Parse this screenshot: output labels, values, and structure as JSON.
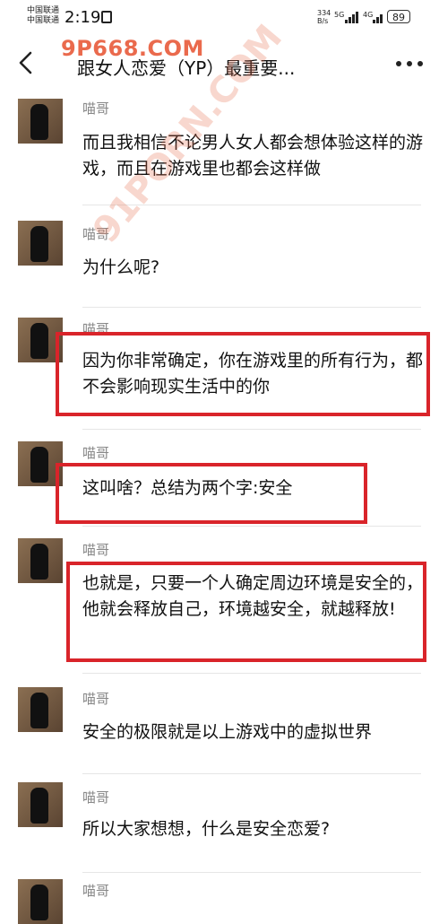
{
  "status_bar": {
    "carrier_1": "中国联通",
    "carrier_2": "中国联通",
    "time": "2:19",
    "net_speed_value": "334",
    "net_speed_unit": "B/s",
    "sim1_type": "5G",
    "sim2_type": "4G",
    "battery": "89"
  },
  "watermark": {
    "top": "9P668.COM",
    "diagonal": "91PORN.COM"
  },
  "header": {
    "title": "跟女人恋爱（YP）最重要..."
  },
  "messages": [
    {
      "sender": "喵哥",
      "text": "而且我相信不论男人女人都会想体验这样的游戏，而且在游戏里也都会这样做",
      "highlighted": false
    },
    {
      "sender": "喵哥",
      "text": "为什么呢?",
      "highlighted": false
    },
    {
      "sender": "喵哥",
      "text": "因为你非常确定，你在游戏里的所有行为，都不会影响现实生活中的你",
      "highlighted": true
    },
    {
      "sender": "喵哥",
      "text": "这叫啥？总结为两个字:安全",
      "highlighted": true
    },
    {
      "sender": "喵哥",
      "text": "也就是，只要一个人确定周边环境是安全的，他就会释放自己，环境越安全，就越释放!",
      "highlighted": true
    },
    {
      "sender": "喵哥",
      "text": "安全的极限就是以上游戏中的虚拟世界",
      "highlighted": false
    },
    {
      "sender": "喵哥",
      "text": "所以大家想想，什么是安全恋爱?",
      "highlighted": false
    },
    {
      "sender": "喵哥",
      "text": "",
      "highlighted": false
    }
  ],
  "colors": {
    "highlight_border": "#d9242a",
    "name_gray": "#888888"
  }
}
